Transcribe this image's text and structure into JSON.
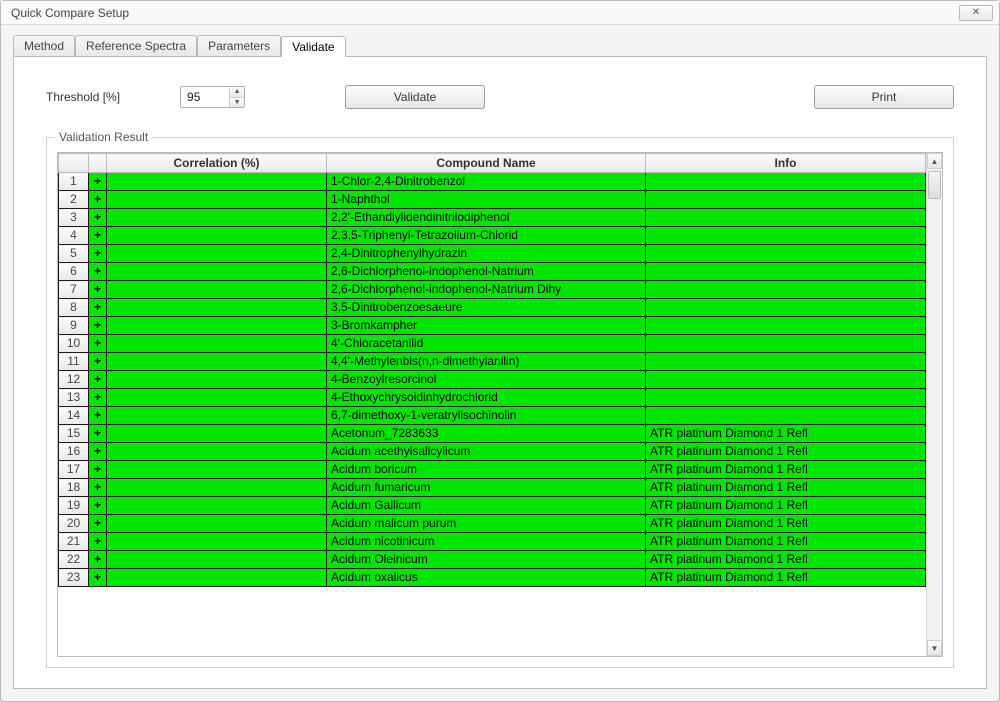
{
  "window": {
    "title": "Quick Compare Setup",
    "close_label": "✕"
  },
  "tabs": [
    {
      "label": "Method",
      "selected": false
    },
    {
      "label": "Reference Spectra",
      "selected": false
    },
    {
      "label": "Parameters",
      "selected": false
    },
    {
      "label": "Validate",
      "selected": true
    }
  ],
  "threshold": {
    "label": "Threshold [%]",
    "value": "95"
  },
  "buttons": {
    "validate": "Validate",
    "print": "Print"
  },
  "group_title": "Validation Result",
  "columns": {
    "rownum": "",
    "mark": "",
    "correlation": "Correlation (%)",
    "compound": "Compound Name",
    "info": "Info"
  },
  "rows": [
    {
      "n": 1,
      "mark": "+",
      "correlation": "",
      "compound": "1-Chlor-2,4-Dinitrobenzol",
      "info": ""
    },
    {
      "n": 2,
      "mark": "+",
      "correlation": "",
      "compound": "1-Naphthol",
      "info": ""
    },
    {
      "n": 3,
      "mark": "+",
      "correlation": "",
      "compound": "2,2'-Ethandiylidendinitrilodiphenol",
      "info": ""
    },
    {
      "n": 4,
      "mark": "+",
      "correlation": "",
      "compound": "2,3,5-Triphenyl-Tetrazolium-Chlorid",
      "info": ""
    },
    {
      "n": 5,
      "mark": "+",
      "correlation": "",
      "compound": "2,4-Dinitrophenylhydrazin",
      "info": ""
    },
    {
      "n": 6,
      "mark": "+",
      "correlation": "",
      "compound": "2,6-Dichlorphenol-indophenol-Natrium",
      "info": ""
    },
    {
      "n": 7,
      "mark": "+",
      "correlation": "",
      "compound": "2,6-Dichlorphenol-indophenol-Natrium Dihy",
      "info": ""
    },
    {
      "n": 8,
      "mark": "+",
      "correlation": "",
      "compound": "3,5-Dinitrobenzoesaeure",
      "info": ""
    },
    {
      "n": 9,
      "mark": "+",
      "correlation": "",
      "compound": "3-Bromkampher",
      "info": ""
    },
    {
      "n": 10,
      "mark": "+",
      "correlation": "",
      "compound": "4'-Chloracetanilid",
      "info": ""
    },
    {
      "n": 11,
      "mark": "+",
      "correlation": "",
      "compound": "4,4'-Methylenbis(n,n-dimethylanilin)",
      "info": ""
    },
    {
      "n": 12,
      "mark": "+",
      "correlation": "",
      "compound": "4-Benzoylresorcinol",
      "info": ""
    },
    {
      "n": 13,
      "mark": "+",
      "correlation": "",
      "compound": "4-Ethoxychrysoidinhydrochlorid",
      "info": ""
    },
    {
      "n": 14,
      "mark": "+",
      "correlation": "",
      "compound": "6,7-dimethoxy-1-veratrylisochinolin",
      "info": ""
    },
    {
      "n": 15,
      "mark": "+",
      "correlation": "",
      "compound": "Acetonum_7283633",
      "info": "ATR platinum Diamond 1 Refl"
    },
    {
      "n": 16,
      "mark": "+",
      "correlation": "",
      "compound": "Acidum acethylsalicylicum",
      "info": "ATR platinum Diamond 1 Refl"
    },
    {
      "n": 17,
      "mark": "+",
      "correlation": "",
      "compound": "Acidum boricum",
      "info": "ATR platinum Diamond 1 Refl"
    },
    {
      "n": 18,
      "mark": "+",
      "correlation": "",
      "compound": "Acidum fumaricum",
      "info": "ATR platinum Diamond 1 Refl"
    },
    {
      "n": 19,
      "mark": "+",
      "correlation": "",
      "compound": "Acidum Gallicum",
      "info": "ATR platinum Diamond 1 Refl"
    },
    {
      "n": 20,
      "mark": "+",
      "correlation": "",
      "compound": "Acidum malicum purum",
      "info": "ATR platinum Diamond 1 Refl"
    },
    {
      "n": 21,
      "mark": "+",
      "correlation": "",
      "compound": "Acidum nicotinicum",
      "info": "ATR platinum Diamond 1 Refl"
    },
    {
      "n": 22,
      "mark": "+",
      "correlation": "",
      "compound": "Acidum Oleinicum",
      "info": "ATR platinum Diamond 1 Refl"
    },
    {
      "n": 23,
      "mark": "+",
      "correlation": "",
      "compound": "Acidum oxalicus",
      "info": "ATR platinum Diamond 1 Refl"
    }
  ]
}
